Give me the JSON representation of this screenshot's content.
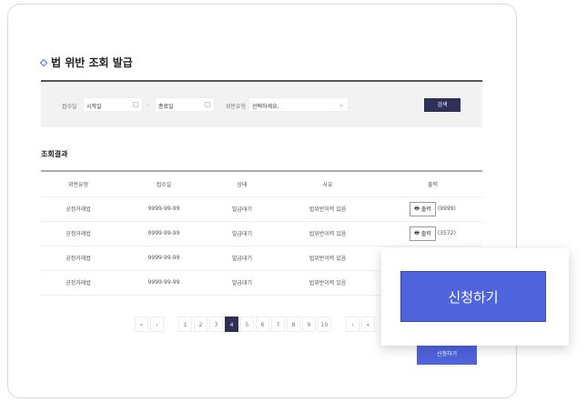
{
  "title": "법 위반 조회 발급",
  "search": {
    "date_label": "접수일",
    "start_placeholder": "시작일",
    "separator": "-",
    "end_placeholder": "종료일",
    "type_label": "위반유형",
    "type_value": "선택하세요.",
    "button": "검색"
  },
  "results_title": "조회결과",
  "table": {
    "headers": [
      "위반유형",
      "접수일",
      "상태",
      "사유",
      "출력"
    ],
    "rows": [
      {
        "type": "공정거래법",
        "date": "9999-99-99",
        "status": "발급대기",
        "reason": "법위반이력 있음",
        "print": "출력",
        "count": "(9999)"
      },
      {
        "type": "공정거래법",
        "date": "9999-99-99",
        "status": "발급대기",
        "reason": "법위반이력 있음",
        "print": "출력",
        "count": "(3572)"
      },
      {
        "type": "공정거래법",
        "date": "9999-99-99",
        "status": "발급대기",
        "reason": "법위반이력 있음"
      },
      {
        "type": "공정거래법",
        "date": "9999-99-99",
        "status": "발급대기",
        "reason": "법위반이력 있음"
      }
    ]
  },
  "pagination": {
    "first": "«",
    "prev": "‹",
    "pages": [
      "1",
      "2",
      "3",
      "4",
      "5",
      "6",
      "7",
      "8",
      "9",
      "10"
    ],
    "current": "4",
    "next": "›",
    "last": "»"
  },
  "popup_button": "신청하기",
  "apply_button": "신청하기",
  "accent": "#4f63dc"
}
